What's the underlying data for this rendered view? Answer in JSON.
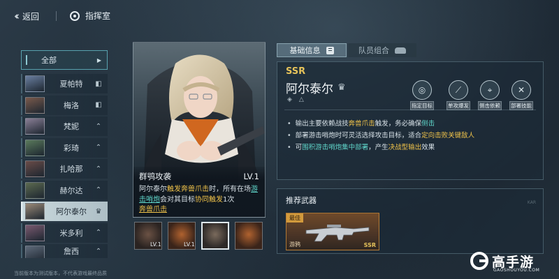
{
  "topbar": {
    "back_label": "返回",
    "command_label": "指挥室"
  },
  "sidebar": {
    "filter_label": "全部",
    "items": [
      {
        "name": "夏帕特",
        "badge": "◧",
        "selected": false,
        "color": "#6a7fa0"
      },
      {
        "name": "梅洛",
        "badge": "◧",
        "selected": false,
        "color": "#7a5a4c"
      },
      {
        "name": "梵妮",
        "badge": "⌃",
        "selected": false,
        "color": "#8a7f96"
      },
      {
        "name": "彩琦",
        "badge": "⌃",
        "selected": false,
        "color": "#5a7a5c"
      },
      {
        "name": "扎哈那",
        "badge": "⌃",
        "selected": false,
        "color": "#6a4c48"
      },
      {
        "name": "赫尔达",
        "badge": "⌃",
        "selected": false,
        "color": "#5c6a50"
      },
      {
        "name": "阿尔泰尔",
        "badge": "♛",
        "selected": true,
        "color": "#9a8a78"
      },
      {
        "name": "米多利",
        "badge": "⌃",
        "selected": false,
        "color": "#7a5a70"
      },
      {
        "name": "詹西",
        "badge": "⌃",
        "selected": false,
        "color": "#5e6a7a"
      }
    ]
  },
  "footnote": "当前版本为测试版本，不代表游戏最终品质",
  "skill": {
    "name": "群鸮攻袭",
    "level": "LV.1",
    "desc_1": "阿尔泰尔",
    "desc_2": "触发奔兽爪击",
    "desc_3": "时，所有在场",
    "desc_4": "游击哨炮",
    "desc_5": "会对其目标",
    "desc_6": "协同触发",
    "desc_7": "1次",
    "desc_8": "奔兽爪击",
    "icons": [
      {
        "name": "skill-1",
        "level": "LV.1"
      },
      {
        "name": "skill-2",
        "level": "LV.1"
      },
      {
        "name": "skill-3",
        "level": ""
      },
      {
        "name": "skill-4",
        "level": ""
      }
    ]
  },
  "tabs": {
    "basic_label": "基础信息",
    "team_label": "队员组合"
  },
  "hero": {
    "rarity": "SSR",
    "name": "阿尔泰尔",
    "tags": [
      {
        "label": "指定目标",
        "glyph": "◎"
      },
      {
        "label": "单攻爆发",
        "glyph": "⟋"
      },
      {
        "label": "侧击依赖",
        "glyph": "⌖"
      },
      {
        "label": "部署技能",
        "glyph": "✕"
      }
    ],
    "bullet_1a": "输出主要依赖战技",
    "bullet_1b": "奔兽爪击",
    "bullet_1c": "触发，务必确保",
    "bullet_1d": "侧击",
    "bullet_2a": "部署游击哨炮时可灵活选择攻击目标，适合",
    "bullet_2b": "定向击败关键敌人",
    "bullet_3a": "可",
    "bullet_3b": "围积游击哨炮集中部署",
    "bullet_3c": "，产生",
    "bullet_3d": "决战型输出",
    "bullet_3e": "效果"
  },
  "weapon": {
    "title": "推荐武器",
    "best_label": "最佳",
    "name": "游鸦",
    "rarity": "SSR",
    "ghost_text": "KAR"
  },
  "logo": {
    "text": "高手游",
    "url": "GAOSHOUYOU.COM"
  },
  "colors": {
    "gold": "#f0c34a",
    "cyan": "#5fd4c9",
    "rarity": "#e5c25a"
  }
}
